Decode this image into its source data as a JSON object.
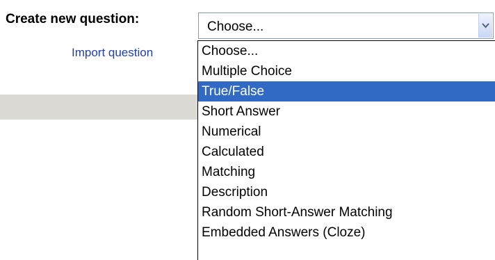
{
  "form": {
    "create_label": "Create new question:",
    "import_link": "Import question",
    "select_value": "Choose...",
    "arrow_icon": "chevron-down-icon"
  },
  "dropdown": {
    "selected_option": "True/False",
    "options": [
      "Choose...",
      "Multiple Choice",
      "True/False",
      "Short Answer",
      "Numerical",
      "Calculated",
      "Matching",
      "Description",
      "Random Short-Answer Matching",
      "Embedded Answers (Cloze)"
    ]
  },
  "colors": {
    "highlight": "#316ac5",
    "link": "#1f3fae",
    "band": "#dcdad5"
  }
}
